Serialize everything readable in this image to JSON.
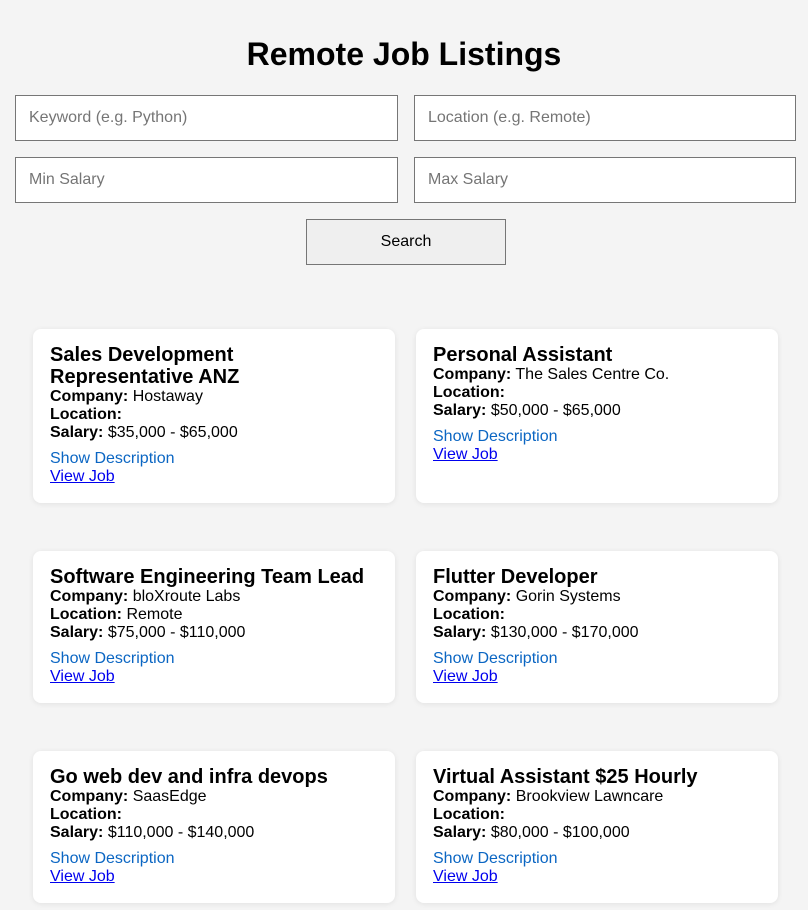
{
  "page": {
    "title": "Remote Job Listings"
  },
  "search": {
    "keyword_placeholder": "Keyword (e.g. Python)",
    "location_placeholder": "Location (e.g. Remote)",
    "min_salary_placeholder": "Min Salary",
    "max_salary_placeholder": "Max Salary",
    "button_label": "Search"
  },
  "labels": {
    "company": "Company:",
    "location": "Location:",
    "salary": "Salary:",
    "show_description": "Show Description",
    "view_job": "View Job"
  },
  "jobs": [
    {
      "title": "Sales Development Representative ANZ",
      "company": "Hostaway",
      "location": "",
      "salary": "$35,000 - $65,000"
    },
    {
      "title": "Personal Assistant",
      "company": "The Sales Centre Co.",
      "location": "",
      "salary": "$50,000 - $65,000"
    },
    {
      "title": "Software Engineering Team Lead",
      "company": "bloXroute Labs",
      "location": "Remote",
      "salary": "$75,000 - $110,000"
    },
    {
      "title": "Flutter Developer",
      "company": "Gorin Systems",
      "location": "",
      "salary": "$130,000 - $170,000"
    },
    {
      "title": "Go web dev and infra devops",
      "company": "SaasEdge",
      "location": "",
      "salary": "$110,000 - $140,000"
    },
    {
      "title": "Virtual Assistant $25 Hourly",
      "company": "Brookview Lawncare",
      "location": "",
      "salary": "$80,000 - $100,000"
    }
  ]
}
